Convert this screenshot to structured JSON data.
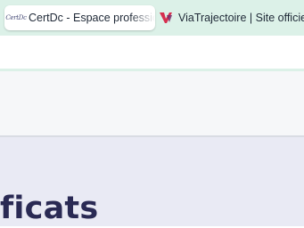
{
  "tabs": [
    {
      "title": "CertDc - Espace professionnel",
      "favicon": "certdc-logo-icon",
      "favicon_text": "CertDc",
      "active": true
    },
    {
      "title": "ViaTrajectoire | Site officiel",
      "favicon": "viatrajectoire-logo-icon",
      "active": false
    }
  ],
  "page": {
    "heading": "ficats"
  },
  "colors": {
    "tabstrip": "#dcf1e8",
    "banner": "#f6f7f9",
    "content": "#e9eaf4",
    "heading": "#2a2a54",
    "via_red": "#d62f4f"
  }
}
